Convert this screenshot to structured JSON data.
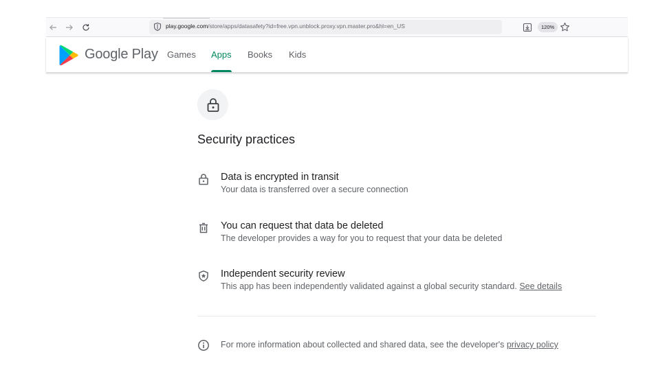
{
  "browser": {
    "url_host": "play.google.com",
    "url_path": "/store/apps/datasafety?id=free.vpn.unblock.proxy.vpn.master.pro&hl=en_US",
    "zoom": "120%"
  },
  "header": {
    "brand": "Google Play",
    "nav": [
      {
        "label": "Games",
        "active": false
      },
      {
        "label": "Apps",
        "active": true
      },
      {
        "label": "Books",
        "active": false
      },
      {
        "label": "Kids",
        "active": false
      }
    ],
    "accent_color": "#01875f"
  },
  "main": {
    "section_title": "Security practices",
    "practices": [
      {
        "icon": "lock-icon",
        "title": "Data is encrypted in transit",
        "description": "Your data is transferred over a secure connection"
      },
      {
        "icon": "trash-icon",
        "title": "You can request that data be deleted",
        "description": "The developer provides a way for you to request that your data be deleted"
      },
      {
        "icon": "shield-star-icon",
        "title": "Independent security review",
        "description": "This app has been independently validated against a global security standard.",
        "link": "See details"
      }
    ],
    "footer_info": {
      "icon": "info-icon",
      "text": "For more information about collected and shared data, see the developer's",
      "link": "privacy policy"
    }
  }
}
